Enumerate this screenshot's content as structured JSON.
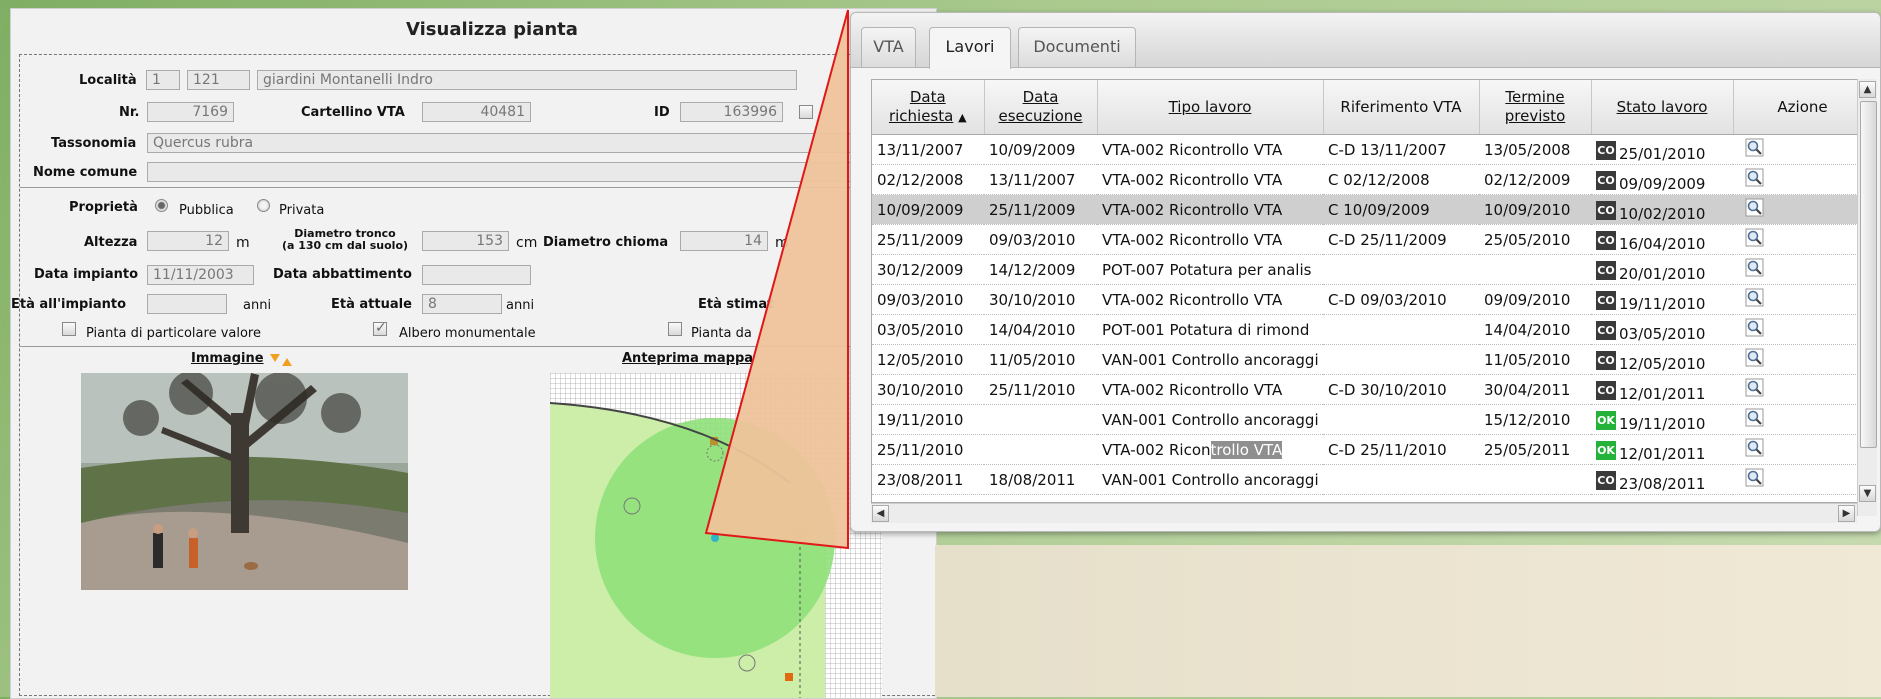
{
  "form": {
    "title": "Visualizza pianta",
    "localita_label": "Località",
    "localita_1": "1",
    "localita_2": "121",
    "localita_name": "giardini Montanelli Indro",
    "nr_label": "Nr.",
    "nr_value": "7169",
    "cartellino_label": "Cartellino VTA",
    "cartellino_value": "40481",
    "id_label": "ID",
    "id_value": "163996",
    "tassonomia_label": "Tassonomia",
    "tassonomia_value": "Quercus rubra",
    "nome_comune_label": "Nome comune",
    "nome_comune_value": "",
    "proprieta_label": "Proprietà",
    "proprieta_options": [
      "Pubblica",
      "Privata"
    ],
    "altezza_label": "Altezza",
    "altezza_value": "12",
    "altezza_unit": "m",
    "diam_tronco_label": "Diametro tronco",
    "diam_tronco_sub": "(a 130 cm dal suolo)",
    "diam_tronco_value": "153",
    "diam_tronco_unit": "cm",
    "diam_chioma_label": "Diametro chioma",
    "diam_chioma_value": "14",
    "diam_chioma_unit": "m",
    "data_impianto_label": "Data impianto",
    "data_impianto_value": "11/11/2003",
    "data_abbattimento_label": "Data abbattimento",
    "data_abbattimento_value": "",
    "eta_impianto_label": "Età all'impianto",
    "eta_impianto_value": "",
    "eta_impianto_unit": "anni",
    "eta_attuale_label": "Età attuale",
    "eta_attuale_value": "8",
    "eta_attuale_unit": "anni",
    "eta_stimata_label": "Età stimat",
    "checkbox_valore": "Pianta di particolare valore",
    "checkbox_monumentale": "Albero monumentale",
    "checkbox_da": "Pianta da",
    "immagine_label": "Immagine",
    "anteprima_label": "Anteprima mappa"
  },
  "popup": {
    "tabs": [
      "VTA",
      "Lavori",
      "Documenti"
    ],
    "active_tab": "Lavori",
    "columns": [
      "Data richiesta",
      "Data esecuzione",
      "Tipo lavoro",
      "Riferimento VTA",
      "Termine previsto",
      "Stato lavoro",
      "Azione"
    ],
    "col_richiesta_1": "Data",
    "col_richiesta_2": "richiesta",
    "col_esecuzione_1": "Data",
    "col_esecuzione_2": "esecuzione",
    "col_tipo": "Tipo lavoro",
    "col_rif": "Riferimento VTA",
    "col_termine_1": "Termine",
    "col_termine_2": "previsto",
    "col_stato": "Stato lavoro",
    "col_azione": "Azione",
    "sort_indicator": "▲",
    "rows": [
      {
        "richiesta": "13/11/2007",
        "esecuzione": "10/09/2009",
        "tipo": "VTA-002 Ricontrollo VTA",
        "rif": "C-D 13/11/2007",
        "termine": "13/05/2008",
        "badge": "CO",
        "stato": "25/01/2010"
      },
      {
        "richiesta": "02/12/2008",
        "esecuzione": "13/11/2007",
        "tipo": "VTA-002 Ricontrollo VTA",
        "rif": "C 02/12/2008",
        "termine": "02/12/2009",
        "badge": "CO",
        "stato": "09/09/2009"
      },
      {
        "richiesta": "10/09/2009",
        "esecuzione": "25/11/2009",
        "tipo": "VTA-002 Ricontrollo VTA",
        "rif": "C 10/09/2009",
        "termine": "10/09/2010",
        "badge": "CO",
        "stato": "10/02/2010"
      },
      {
        "richiesta": "25/11/2009",
        "esecuzione": "09/03/2010",
        "tipo": "VTA-002 Ricontrollo VTA",
        "rif": "C-D 25/11/2009",
        "termine": "25/05/2010",
        "badge": "CO",
        "stato": "16/04/2010"
      },
      {
        "richiesta": "30/12/2009",
        "esecuzione": "14/12/2009",
        "tipo": "POT-007 Potatura per analis",
        "rif": "",
        "termine": "",
        "badge": "CO",
        "stato": "20/01/2010"
      },
      {
        "richiesta": "09/03/2010",
        "esecuzione": "30/10/2010",
        "tipo": "VTA-002 Ricontrollo VTA",
        "rif": "C-D 09/03/2010",
        "termine": "09/09/2010",
        "badge": "CO",
        "stato": "19/11/2010"
      },
      {
        "richiesta": "03/05/2010",
        "esecuzione": "14/04/2010",
        "tipo": "POT-001 Potatura di rimond",
        "rif": "",
        "termine": "14/04/2010",
        "badge": "CO",
        "stato": "03/05/2010"
      },
      {
        "richiesta": "12/05/2010",
        "esecuzione": "11/05/2010",
        "tipo": "VAN-001 Controllo ancoraggi",
        "rif": "",
        "termine": "11/05/2010",
        "badge": "CO",
        "stato": "12/05/2010"
      },
      {
        "richiesta": "30/10/2010",
        "esecuzione": "25/11/2010",
        "tipo": "VTA-002 Ricontrollo VTA",
        "rif": "C-D 30/10/2010",
        "termine": "30/04/2011",
        "badge": "CO",
        "stato": "12/01/2011"
      },
      {
        "richiesta": "19/11/2010",
        "esecuzione": "",
        "tipo": "VAN-001 Controllo ancoraggi",
        "rif": "",
        "termine": "15/12/2010",
        "badge": "OK",
        "stato": "19/11/2010"
      },
      {
        "richiesta": "25/11/2010",
        "esecuzione": "",
        "tipo": "VTA-002 Ricontrollo VTA",
        "rif": "C-D 25/11/2010",
        "termine": "25/05/2011",
        "badge": "OK",
        "stato": "12/01/2011"
      },
      {
        "richiesta": "23/08/2011",
        "esecuzione": "18/08/2011",
        "tipo": "VAN-001 Controllo ancoraggi",
        "rif": "",
        "termine": "",
        "badge": "CO",
        "stato": "23/08/2011"
      }
    ],
    "selected_row": 2,
    "highlight_row": 10,
    "highlight_text": "trollo VTA"
  },
  "colors": {
    "ok_badge": "#25b23a",
    "co_badge": "#3a3a3a",
    "callout_stroke": "#e01818",
    "callout_fill": "#e9b98a"
  },
  "icons": {
    "azione": "magnifier-icon",
    "sort": "sort-asc-icon",
    "immagine": "toggle-arrows-icon"
  }
}
